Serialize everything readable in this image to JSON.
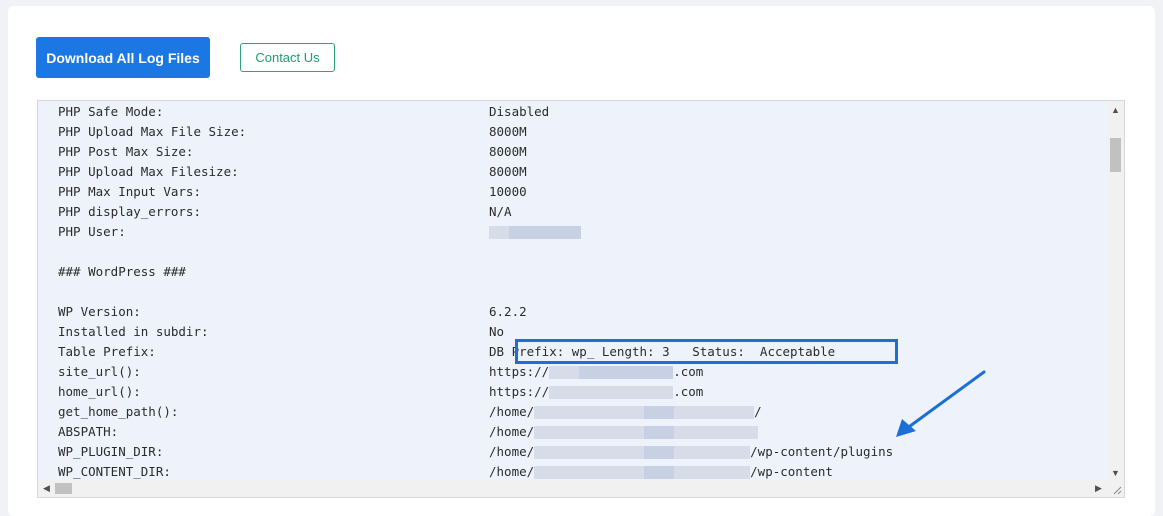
{
  "actions": {
    "download_label": "Download All Log Files",
    "contact_label": "Contact Us"
  },
  "log": {
    "lines": [
      {
        "key": "PHP Safe Mode:",
        "value": "Disabled"
      },
      {
        "key": "PHP Upload Max File Size:",
        "value": "8000M"
      },
      {
        "key": "PHP Post Max Size:",
        "value": "8000M"
      },
      {
        "key": "PHP Upload Max Filesize:",
        "value": "8000M"
      },
      {
        "key": "PHP Max Input Vars:",
        "value": "10000"
      },
      {
        "key": "PHP display_errors:",
        "value": "N/A"
      },
      {
        "key": "PHP User:",
        "value": ""
      },
      {
        "key": "",
        "value": ""
      },
      {
        "key": "### WordPress ###",
        "value": ""
      },
      {
        "key": "",
        "value": ""
      },
      {
        "key": "WP Version:",
        "value": "6.2.2"
      },
      {
        "key": "Installed in subdir:",
        "value": "No"
      },
      {
        "key": "Table Prefix:",
        "value": "DB Prefix: wp_ Length: 3   Status:  Acceptable"
      },
      {
        "key": "site_url():",
        "value_prefix": "https://",
        "value_suffix": ".com"
      },
      {
        "key": "home_url():",
        "value_prefix": "https://",
        "value_suffix": ".com"
      },
      {
        "key": "get_home_path():",
        "value_prefix": "/home/",
        "value_suffix": "/"
      },
      {
        "key": "ABSPATH:",
        "value_prefix": "/home/",
        "value_suffix": ""
      },
      {
        "key": "WP_PLUGIN_DIR:",
        "value_prefix": "/home/",
        "value_suffix": "/wp-content/plugins"
      },
      {
        "key": "WP_CONTENT_DIR:",
        "value_prefix": "/home/",
        "value_suffix": "/wp-content"
      }
    ]
  },
  "colors": {
    "primary": "#1b77e3",
    "outline_green": "#1f9f6c",
    "highlight_blue": "#1c6fd6"
  }
}
